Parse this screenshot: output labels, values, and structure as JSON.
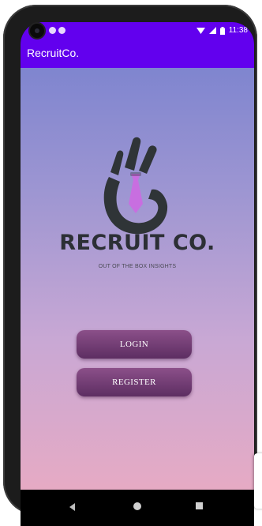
{
  "status_bar": {
    "time": "11:38",
    "icons": [
      "notification-icon",
      "notification-icon",
      "wifi-icon",
      "signal-icon",
      "battery-icon"
    ]
  },
  "app_bar": {
    "title": "RecruitCo."
  },
  "main": {
    "logo_icon": "ok-hand-tie-logo",
    "brand_name": "RECRUIT CO.",
    "tagline": "OUT OF THE BOX INSIGHTS",
    "login_label": "LOGIN",
    "register_label": "REGISTER"
  },
  "nav_bar": {
    "icons": [
      "back-icon",
      "home-icon",
      "recent-apps-icon"
    ]
  },
  "colors": {
    "app_bar": "#6200ee",
    "button_top": "#8b4f89",
    "button_bottom": "#5d2e62",
    "gradient_top": "#7f85cf",
    "gradient_bottom": "#e6aac4",
    "logo_dark": "#2f3437",
    "logo_tie": "#c86ee0"
  }
}
